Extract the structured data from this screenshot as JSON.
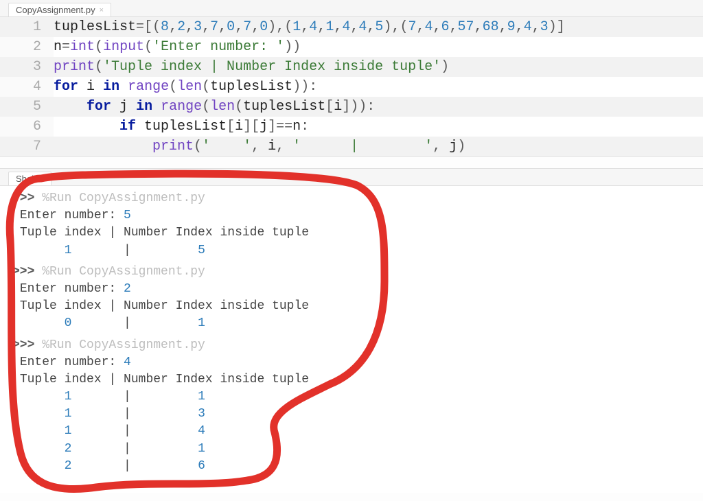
{
  "editor_tab": {
    "label": "CopyAssignment.py"
  },
  "code": {
    "l1": "tuplesList=[(8,2,3,7,0,7,0),(1,4,1,4,4,5),(7,4,6,57,68,9,4,3)]",
    "l2": "n=int(input('Enter number: '))",
    "l3": "print('Tuple index | Number Index inside tuple')",
    "l4": "for i in range(len(tuplesList)):",
    "l5": "    for j in range(len(tuplesList[i])):",
    "l6": "        if tuplesList[i][j]==n:",
    "l7": "            print('    ', i, '      |        ', j)"
  },
  "shell_tab": {
    "label": "Shell"
  },
  "shell": {
    "prompt": ">>> ",
    "run_cmd": "%Run CopyAssignment.py",
    "runs": [
      {
        "input_label": "Enter number: ",
        "input_value": "5",
        "header": "Tuple index | Number Index inside tuple",
        "rows": [
          {
            "ti": "1",
            "ni": "5"
          }
        ]
      },
      {
        "input_label": "Enter number: ",
        "input_value": "2",
        "header": "Tuple index | Number Index inside tuple",
        "rows": [
          {
            "ti": "0",
            "ni": "1"
          }
        ]
      },
      {
        "input_label": "Enter number: ",
        "input_value": "4",
        "header": "Tuple index | Number Index inside tuple",
        "rows": [
          {
            "ti": "1",
            "ni": "1"
          },
          {
            "ti": "1",
            "ni": "3"
          },
          {
            "ti": "1",
            "ni": "4"
          },
          {
            "ti": "2",
            "ni": "1"
          },
          {
            "ti": "2",
            "ni": "6"
          }
        ]
      }
    ]
  }
}
